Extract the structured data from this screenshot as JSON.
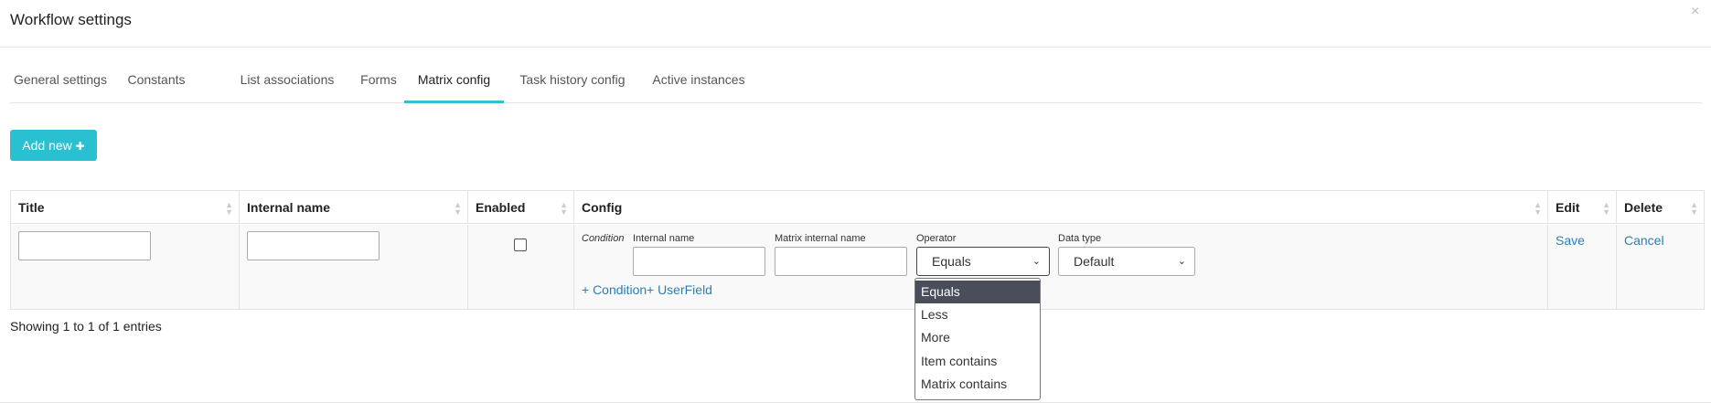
{
  "header": {
    "title": "Workflow settings",
    "close_symbol": "×"
  },
  "tabs": [
    {
      "label": "General settings",
      "active": false
    },
    {
      "label": "Constants",
      "active": false
    },
    {
      "label": "List associations",
      "active": false
    },
    {
      "label": "Forms",
      "active": false
    },
    {
      "label": "Matrix config",
      "active": true
    },
    {
      "label": "Task history config",
      "active": false
    },
    {
      "label": "Active instances",
      "active": false
    }
  ],
  "toolbar": {
    "add_label": "Add new",
    "add_icon": "plus-icon",
    "add_symbol": "✚"
  },
  "table": {
    "columns": [
      "Title",
      "Internal name",
      "Enabled",
      "Config",
      "Edit",
      "Delete"
    ],
    "sort_symbol": "▲▼",
    "row": {
      "title_value": "",
      "internal_name_value": "",
      "enabled": false,
      "config": {
        "condition_label": "Condition",
        "internal_name_label": "Internal name",
        "internal_name_value": "",
        "matrix_internal_name_label": "Matrix internal name",
        "matrix_internal_name_value": "",
        "operator_label": "Operator",
        "operator_value": "Equals",
        "data_type_label": "Data type",
        "data_type_value": "Default",
        "add_condition_link": "+ Condition",
        "add_userfield_link": "+ UserField"
      },
      "edit_link": "Save",
      "delete_link": "Cancel"
    }
  },
  "operator_dropdown": {
    "options": [
      "Equals",
      "Less",
      "More",
      "Item contains",
      "Matrix contains"
    ],
    "selected": "Equals"
  },
  "footer": {
    "info": "Showing 1 to 1 of 1 entries"
  },
  "colors": {
    "accent": "#29c1d2",
    "link": "#2a7fb8",
    "selected_option": "#4a4e5a"
  }
}
